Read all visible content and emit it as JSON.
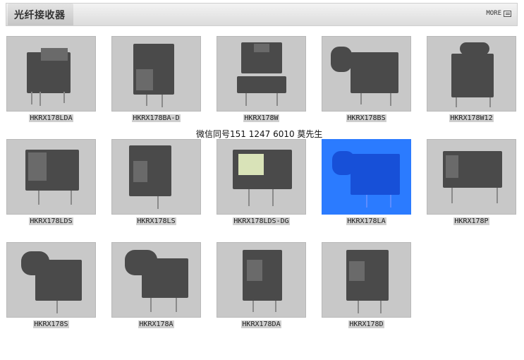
{
  "header": {
    "title": "光纤接收器",
    "more_label": "MORE"
  },
  "contact": "微信同号151 1247 6010 莫先生",
  "products": [
    {
      "label": "HKRX178LDA"
    },
    {
      "label": "HKRX178BA-D"
    },
    {
      "label": "HKRX178W"
    },
    {
      "label": "HKRX178BS"
    },
    {
      "label": "HKRX178W12"
    },
    {
      "label": "HKRX178LDS"
    },
    {
      "label": "HKRX178LS"
    },
    {
      "label": "HKRX178LDS-DG"
    },
    {
      "label": "HKRX178LA"
    },
    {
      "label": "HKRX178P"
    },
    {
      "label": "HKRX178S"
    },
    {
      "label": "HKRX178A"
    },
    {
      "label": "HKRX178DA"
    },
    {
      "label": "HKRX178D"
    }
  ],
  "colors": {
    "selected": "#2b7bff",
    "thumb_bg": "#c8c8c8"
  }
}
